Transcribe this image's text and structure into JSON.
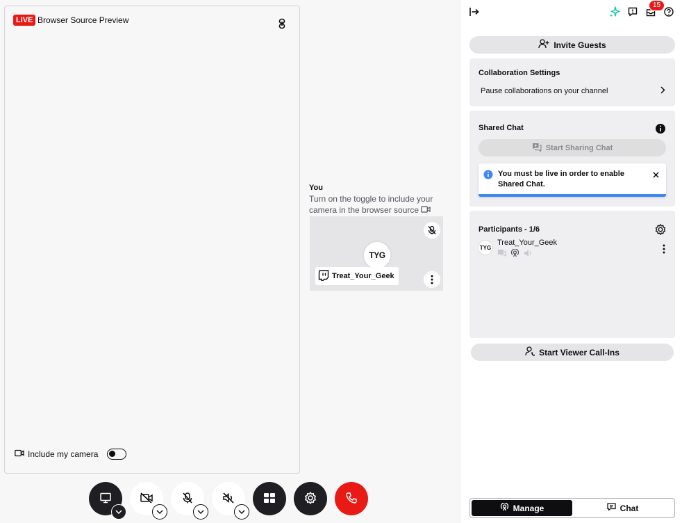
{
  "preview": {
    "live_label": "LIVE",
    "title": "Browser Source Preview",
    "include_camera_label": "Include my camera",
    "include_camera_enabled": false
  },
  "you": {
    "title": "You",
    "description": "Turn on the toggle to include your camera in the browser source",
    "avatar_text": "TYG",
    "name": "Treat_Your_Geek"
  },
  "controls": [
    {
      "name": "screen-share",
      "icon": "monitor-icon",
      "has_dropdown": true
    },
    {
      "name": "camera",
      "icon": "camera-off-icon",
      "has_dropdown": true
    },
    {
      "name": "microphone",
      "icon": "mic-off-icon",
      "has_dropdown": true
    },
    {
      "name": "speaker",
      "icon": "speaker-off-icon",
      "has_dropdown": true
    },
    {
      "name": "layout",
      "icon": "grid-icon",
      "has_dropdown": false
    },
    {
      "name": "settings",
      "icon": "gear-icon",
      "has_dropdown": false
    },
    {
      "name": "leave",
      "icon": "phone-icon",
      "has_dropdown": false
    }
  ],
  "topbar": {
    "notification_count": "15"
  },
  "invite_guests_label": "Invite Guests",
  "collaboration": {
    "title": "Collaboration Settings",
    "row_label": "Pause collaborations on your channel"
  },
  "shared_chat": {
    "title": "Shared Chat",
    "button_label": "Start Sharing Chat",
    "alert_text": "You must be live in order to enable Shared Chat."
  },
  "participants": {
    "title": "Participants - 1/6",
    "items": [
      {
        "avatar_text": "TYG",
        "name": "Treat_Your_Geek"
      }
    ]
  },
  "viewer_callins_label": "Start Viewer Call-Ins",
  "tabs": {
    "manage": "Manage",
    "chat": "Chat"
  },
  "colors": {
    "live_red": "#e91916",
    "accent_green": "#00c8a0",
    "info_blue": "#3d86f5"
  }
}
